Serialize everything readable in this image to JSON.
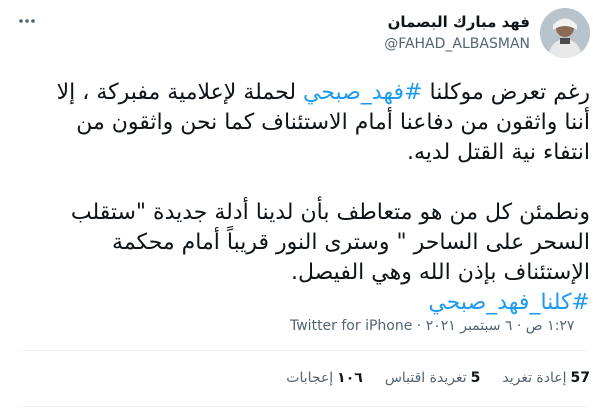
{
  "author": {
    "name": "فهد مبارك البصمان",
    "handle": "@FAHAD_ALBASMAN"
  },
  "tweet": {
    "para1_a": "رغم تعرض موكلنا ",
    "hashtag1": "#فهد_صبحي",
    "para1_b": " لحملة لإعلامية مفبركة ، إلا أننا واثقون من دفاعنا أمام الاستئناف كما نحن واثقون من انتفاء نية القتل لديه.",
    "para2": "ونطمئن كل من هو متعاطف بأن لدينا أدلة جديدة \"ستقلب السحر على الساحر \" وسترى النور قريباً أمام محكمة الإستئناف بإذن الله وهي الفيصل.",
    "hashtag2": "#كلنا_فهد_صبحي"
  },
  "meta": {
    "timestamp": "١:٢٧ ص · ٦ سبتمبر ٢٠٢١",
    "separator": " · ",
    "source": "Twitter for iPhone"
  },
  "stats": {
    "retweets_count": "57",
    "retweets_label": "إعادة تغريد",
    "quotes_count": "5",
    "quotes_label": "تغريدة اقتباس",
    "likes_count": "١٠٦",
    "likes_label": "إعجابات"
  },
  "colors": {
    "accent": "#1d9bf0",
    "secondary_text": "#536471"
  }
}
